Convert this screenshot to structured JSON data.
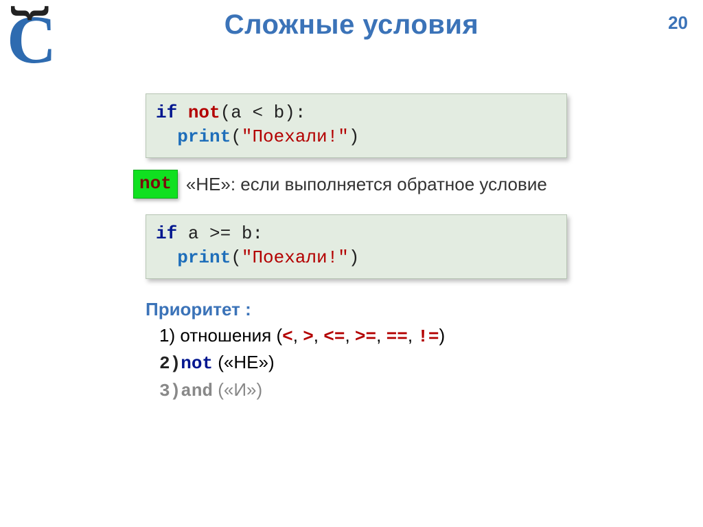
{
  "header": {
    "title": "Сложные условия",
    "page_number": "20",
    "logo_letter": "C",
    "logo_brace": "{"
  },
  "code1": {
    "if": "if",
    "not": "not",
    "cond_open": "(a < b)",
    "colon": ":",
    "print": "print",
    "arg_open": "(",
    "string": "\"Поехали!\"",
    "arg_close": ")"
  },
  "not_row": {
    "badge": "not",
    "desc": "«НЕ»: если выполняется обратное условие"
  },
  "code2": {
    "if": "if",
    "cond": "a >= b",
    "colon": ":",
    "print": "print",
    "arg_open": "(",
    "string": "\"Поехали!\"",
    "arg_close": ")"
  },
  "priority": {
    "heading": "Приоритет :",
    "row1_num": "1)",
    "row1_before": " отношения (",
    "row1_op1": "<",
    "row1_sep1": ", ",
    "row1_op2": ">",
    "row1_sep2": ", ",
    "row1_op3": "<=",
    "row1_sep3": ", ",
    "row1_op4": ">=",
    "row1_sep4": ", ",
    "row1_op5": "==",
    "row1_sep5": ", ",
    "row1_op6": "!=",
    "row1_after": ")",
    "row2_num": "2)",
    "row2_kw": "not",
    "row2_after": " («НЕ»)",
    "row3_num": "3)",
    "row3_kw": "and",
    "row3_after": " («И»)"
  }
}
